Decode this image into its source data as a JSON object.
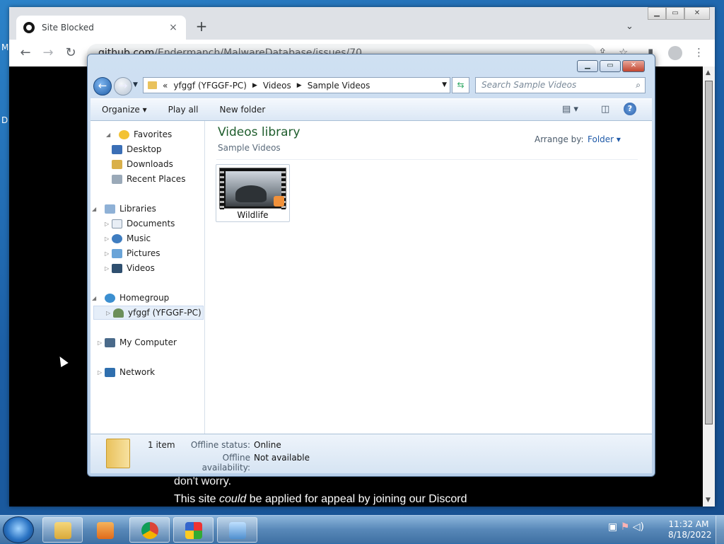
{
  "browser": {
    "tab_title": "Site Blocked",
    "tab_close": "×",
    "new_tab": "+",
    "url_host": "github.com",
    "url_path": "/Endermanch/MalwareDatabase/issues/70",
    "page_line1": "don't worry.",
    "page_line2_a": "This site ",
    "page_line2_em": "could",
    "page_line2_b": " be applied for appeal by joining our Discord"
  },
  "desktop": {
    "edge_letter_1": "M",
    "edge_letter_2": "D"
  },
  "explorer": {
    "window_buttons": {
      "minimize": "▁",
      "maximize": "▭",
      "close": "✕"
    },
    "address": {
      "prefix": "«",
      "segments": [
        "yfggf (YFGGF-PC)",
        "Videos",
        "Sample Videos"
      ]
    },
    "search_placeholder": "Search Sample Videos",
    "commands": [
      "Organize ▾",
      "Play all",
      "New folder"
    ],
    "nav": {
      "favorites": {
        "label": "Favorites",
        "items": [
          "Desktop",
          "Downloads",
          "Recent Places"
        ]
      },
      "libraries": {
        "label": "Libraries",
        "items": [
          "Documents",
          "Music",
          "Pictures",
          "Videos"
        ]
      },
      "homegroup": {
        "label": "Homegroup",
        "items": [
          "yfggf (YFGGF-PC)"
        ]
      },
      "computer": "My Computer",
      "network": "Network"
    },
    "library_title": "Videos library",
    "library_subtitle": "Sample Videos",
    "arrange_label": "Arrange by:",
    "arrange_value": "Folder ▾",
    "files": [
      {
        "name": "Wildlife"
      }
    ],
    "details": {
      "count": "1 item",
      "offline_status_label": "Offline status:",
      "offline_status_value": "Online",
      "offline_avail_label": "Offline availability:",
      "offline_avail_value": "Not available"
    }
  },
  "taskbar": {
    "time": "11:32 AM",
    "date": "8/18/2022"
  },
  "colors": {
    "library_title": "#1e5d2c",
    "accent_link": "#1f5aa8",
    "chrome_bg": "#dee1e6"
  }
}
